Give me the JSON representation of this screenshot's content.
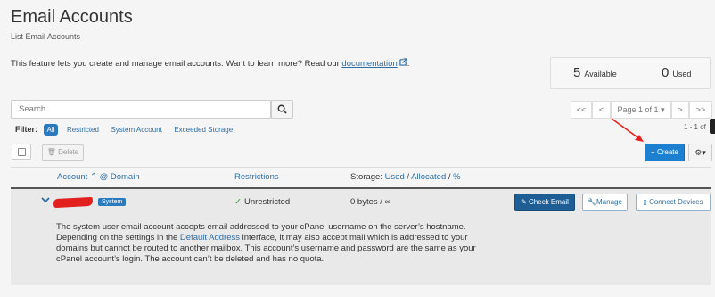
{
  "page": {
    "title": "Email Accounts",
    "subtitle": "List Email Accounts",
    "intro_text": "This feature lets you create and manage email accounts. Want to learn more? Read our",
    "intro_link": "documentation",
    "intro_end": "."
  },
  "stats": {
    "available_count": "5",
    "available_label": "Available",
    "used_count": "0",
    "used_label": "Used"
  },
  "search": {
    "placeholder": "Search"
  },
  "pagination": {
    "first": "<<",
    "prev": "<",
    "page_label": "Page 1 of 1",
    "next": ">",
    "last": ">>",
    "range": "1 - 1 of"
  },
  "filter": {
    "label": "Filter:",
    "options": [
      "All",
      "Restricted",
      "System Account",
      "Exceeded Storage"
    ],
    "selected": "All"
  },
  "toolbar": {
    "delete_label": "Delete",
    "create_label": "+ Create",
    "gear_caret": "▾"
  },
  "table": {
    "headers": {
      "account": "Account",
      "at_domain": "@ Domain",
      "restrictions": "Restrictions",
      "storage_prefix": "Storage:",
      "used": "Used",
      "sep1": "/",
      "allocated": "Allocated",
      "sep2": "/",
      "percent": "%"
    },
    "rows": [
      {
        "badge": "System",
        "restriction": "Unrestricted",
        "storage": "0 bytes / ∞",
        "actions": {
          "check_email": "Check Email",
          "manage": "Manage",
          "connect": "Connect Devices"
        },
        "description_1": "The system user email account accepts email addressed to your cPanel username on the server’s hostname. Depending on the settings in the",
        "description_link": "Default Address",
        "description_2": "interface, it may also accept mail which is addressed to your domains but cannot be routed to another mailbox. This account’s username and password are the same as your cPanel account’s login. The account can’t be deleted and has no quota."
      }
    ]
  },
  "colors": {
    "primary": "#1d7fd0",
    "link": "#2e6da4",
    "success": "#2e8b2e",
    "annotation_arrow": "#e32020"
  }
}
